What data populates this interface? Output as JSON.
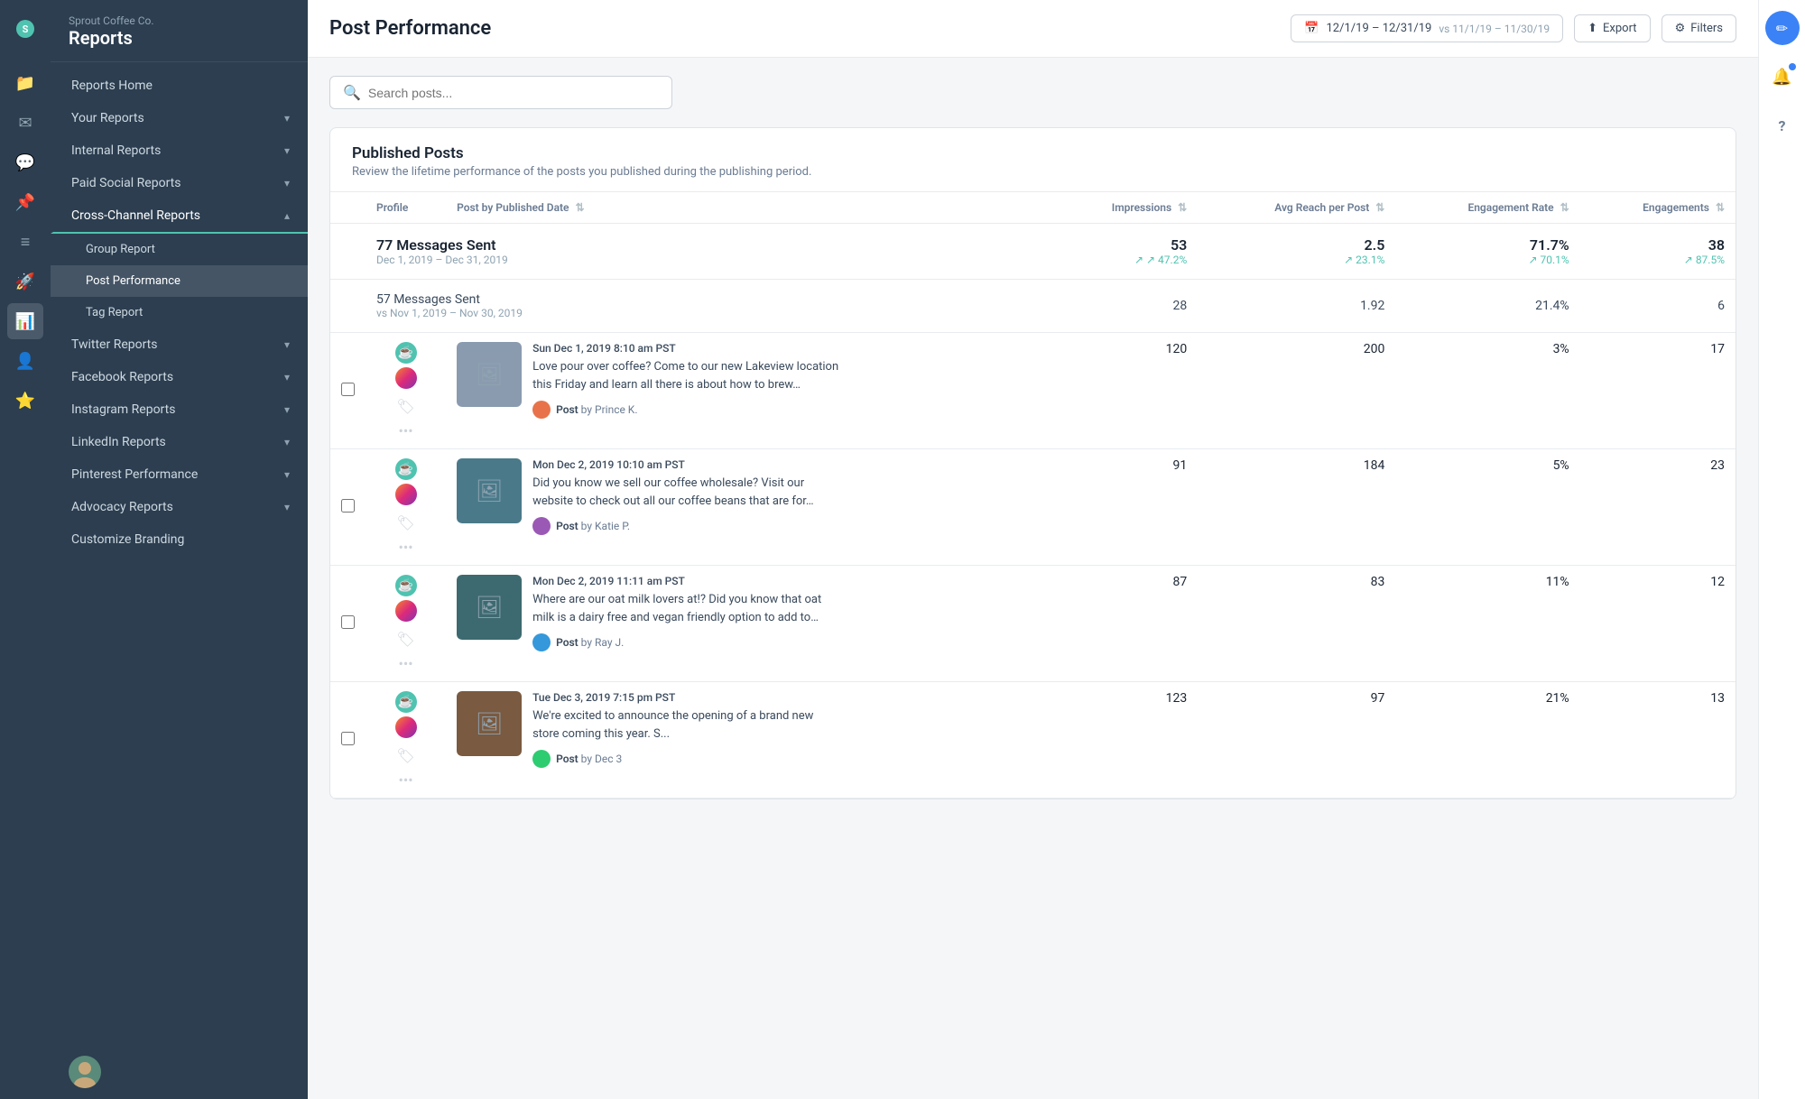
{
  "brand": {
    "company": "Sprout Coffee Co.",
    "section": "Reports"
  },
  "sidebar": {
    "items": [
      {
        "id": "reports-home",
        "label": "Reports Home",
        "indent": false,
        "hasChevron": false
      },
      {
        "id": "your-reports",
        "label": "Your Reports",
        "indent": false,
        "hasChevron": true
      },
      {
        "id": "internal-reports",
        "label": "Internal Reports",
        "indent": false,
        "hasChevron": true
      },
      {
        "id": "paid-social-reports",
        "label": "Paid Social Reports",
        "indent": false,
        "hasChevron": true
      },
      {
        "id": "cross-channel-reports",
        "label": "Cross-Channel Reports",
        "indent": false,
        "hasChevron": true,
        "active": true
      },
      {
        "id": "group-report",
        "label": "Group Report",
        "indent": true,
        "hasChevron": false
      },
      {
        "id": "post-performance",
        "label": "Post Performance",
        "indent": true,
        "hasChevron": false,
        "activeSub": true
      },
      {
        "id": "tag-report",
        "label": "Tag Report",
        "indent": true,
        "hasChevron": false
      },
      {
        "id": "twitter-reports",
        "label": "Twitter Reports",
        "indent": false,
        "hasChevron": true
      },
      {
        "id": "facebook-reports",
        "label": "Facebook Reports",
        "indent": false,
        "hasChevron": true
      },
      {
        "id": "instagram-reports",
        "label": "Instagram Reports",
        "indent": false,
        "hasChevron": true
      },
      {
        "id": "linkedin-reports",
        "label": "LinkedIn Reports",
        "indent": false,
        "hasChevron": true
      },
      {
        "id": "pinterest-performance",
        "label": "Pinterest Performance",
        "indent": false,
        "hasChevron": true
      },
      {
        "id": "advocacy-reports",
        "label": "Advocacy Reports",
        "indent": false,
        "hasChevron": true
      },
      {
        "id": "customize-branding",
        "label": "Customize Branding",
        "indent": false,
        "hasChevron": false
      }
    ]
  },
  "topbar": {
    "title": "Post Performance",
    "date_range": "12/1/19 – 12/31/19",
    "compare_range": "vs 11/1/19 – 11/30/19",
    "export_label": "Export",
    "filters_label": "Filters"
  },
  "search": {
    "placeholder": "Search posts..."
  },
  "published_posts": {
    "heading": "Published Posts",
    "subheading": "Review the lifetime performance of the posts you published during the publishing period.",
    "columns": {
      "profile": "Profile",
      "post_by_date": "Post by Published Date",
      "impressions": "Impressions",
      "avg_reach": "Avg Reach per Post",
      "engagement_rate": "Engagement Rate",
      "engagements": "Engagements"
    },
    "summary_current": {
      "messages_sent": "77 Messages Sent",
      "date_range": "Dec 1, 2019 – Dec 31, 2019",
      "impressions": "53",
      "impressions_delta": "47.2%",
      "avg_reach": "2.5",
      "avg_reach_delta": "23.1%",
      "engagement_rate": "71.7%",
      "engagement_rate_delta": "70.1%",
      "engagements": "38",
      "engagements_delta": "87.5%"
    },
    "summary_compare": {
      "messages_sent": "57 Messages Sent",
      "date_range": "vs Nov 1, 2019 – Nov 30, 2019",
      "impressions": "28",
      "avg_reach": "1.92",
      "engagement_rate": "21.4%",
      "engagements": "6"
    },
    "posts": [
      {
        "id": "post-1",
        "time": "Sun Dec 1, 2019 8:10 am PST",
        "text": "Love pour over coffee? Come to our new Lakeview location this Friday and learn all there is about how to brew…",
        "author_label": "Post",
        "author_name": "Prince K.",
        "impressions": "120",
        "avg_reach": "200",
        "engagement_rate": "3%",
        "engagements": "17",
        "thumb_class": "thumb-1",
        "avatar_class": "av-prince"
      },
      {
        "id": "post-2",
        "time": "Mon Dec 2, 2019 10:10 am PST",
        "text": "Did you know we sell our coffee wholesale? Visit our website to check out all our coffee beans that are for…",
        "author_label": "Post",
        "author_name": "Katie P.",
        "impressions": "91",
        "avg_reach": "184",
        "engagement_rate": "5%",
        "engagements": "23",
        "thumb_class": "thumb-2",
        "avatar_class": "av-katie"
      },
      {
        "id": "post-3",
        "time": "Mon Dec 2, 2019 11:11 am PST",
        "text": "Where are our oat milk lovers at!? Did you know that oat milk is a dairy free and vegan friendly option to add to…",
        "author_label": "Post",
        "author_name": "Ray J.",
        "impressions": "87",
        "avg_reach": "83",
        "engagement_rate": "11%",
        "engagements": "12",
        "thumb_class": "thumb-3",
        "avatar_class": "av-ray"
      },
      {
        "id": "post-4",
        "time": "Tue Dec 3, 2019 7:15 pm PST",
        "text": "We're excited to announce the opening of a brand new store coming this year. S...",
        "author_label": "Post",
        "author_name": "Dec 3",
        "impressions": "123",
        "avg_reach": "97",
        "engagement_rate": "21%",
        "engagements": "13",
        "thumb_class": "thumb-4",
        "avatar_class": "av-dec3"
      }
    ]
  },
  "icons": {
    "search": "🔍",
    "calendar": "📅",
    "export": "⬆",
    "filters": "⚙",
    "chevron_down": "▾",
    "chevron_right": "›",
    "compose": "✏",
    "bell": "🔔",
    "help": "?",
    "folder": "📁",
    "bars": "≡",
    "paper": "📄",
    "pin": "📌",
    "chart": "📊",
    "star": "★",
    "tag": "🏷",
    "more": "•••",
    "image": "🖼",
    "sort": "⇅"
  }
}
